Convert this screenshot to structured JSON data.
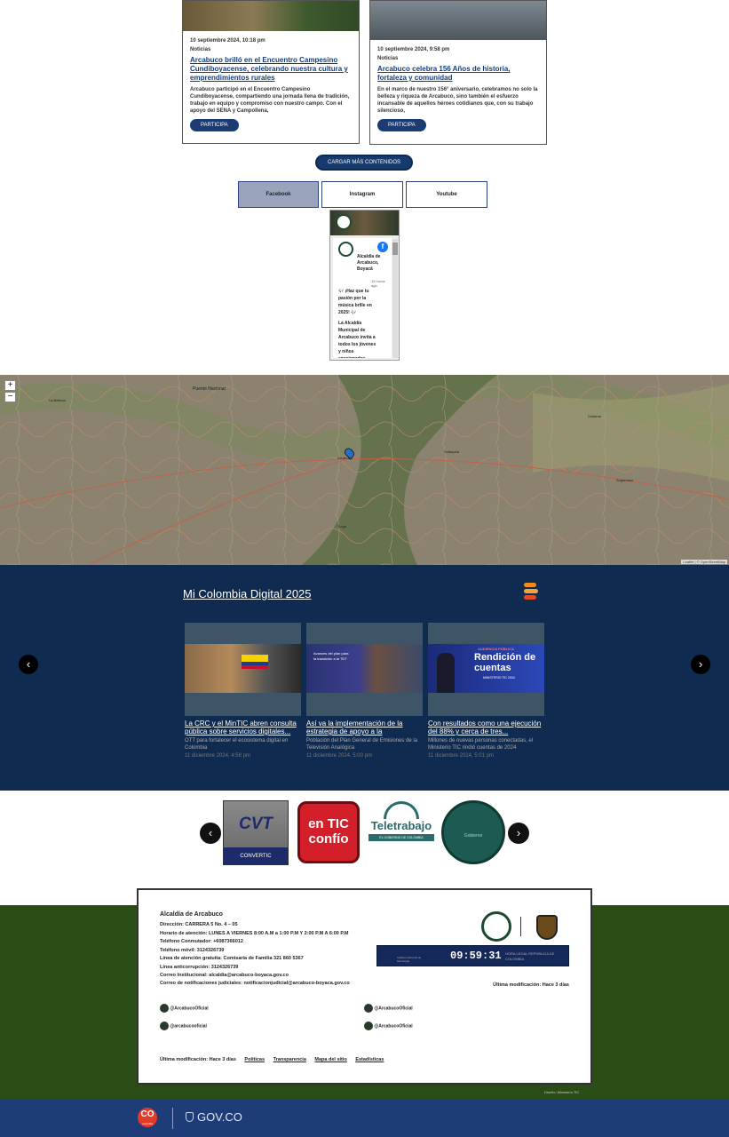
{
  "news": [
    {
      "date": "10 septiembre 2024, 10:18 pm",
      "category": "Noticias",
      "title": "Arcabuco brilló en el Encuentro Campesino Cundiboyacense, celebrando nuestra cultura y emprendimientos rurales",
      "body": "Arcabuco participó en el Encuentro Campesino Cundiboyacense, compartiendo una jornada llena de tradición, trabajo en equipo y compromiso con nuestro campo. Con el apoyo del SENA y Campollena,",
      "button": "PARTICIPA"
    },
    {
      "date": "10 septiembre 2024, 9:58 pm",
      "category": "Noticias",
      "title": "Arcabuco celebra 156 Años de historia, fortaleza y comunidad",
      "body": "En el marco de nuestro 156° aniversario, celebramos no solo la belleza y riqueza de Arcabuco, sino también el esfuerzo incansable de aquellos héroes cotidianos que, con su trabajo silencioso,",
      "button": "PARTICIPA"
    }
  ],
  "load_more": "CARGAR MÁS CONTENIDOS",
  "social_tabs": [
    "Facebook",
    "Instagram",
    "Youtube"
  ],
  "fb_widget": {
    "page_name": "Alcaldía de Arcabuco, Boyacá",
    "time": "15 horas ago",
    "post_line1": "🎶 ¡Haz que tu pasión por la música brille en 2025! 🎶",
    "post_line2": "La Alcaldía Municipal de Arcabuco invita a todos los jóvenes y niños apasionados"
  },
  "map": {
    "zoom_in": "+",
    "zoom_out": "−",
    "places": [
      "Puente Nacional",
      "La Belleza",
      "Arcabuco",
      "Duitama",
      "Sogamoso",
      "Sotaquirá",
      "Tunja"
    ],
    "attribution": "Leaflet | © OpenStreetMap"
  },
  "mi_colombia": {
    "title": "Mi Colombia Digital 2025",
    "prev": "‹",
    "next": "›",
    "cards": [
      {
        "title": "La CRC y el MinTIC abren consulta pública sobre servicios digitales...",
        "summary": "OTT para fortalecer el ecosistema digital en Colombia",
        "date": "11 diciembre 2024, 4:58 pm"
      },
      {
        "title": "Así va la implementación de la estrategia de apoyo a la",
        "summary": "Población del Plan General de Emisiones de la Televisión Analógica",
        "date": "11 diciembre 2024, 5:00 pm",
        "image_text": "Avances del plan para la transición a la TDT"
      },
      {
        "title": "Con resultados como una ejecución del 88% y cerca de tres...",
        "summary": "Millones de nuevas personas conectadas, el Ministerio TIC rindió cuentas de 2024",
        "date": "11 diciembre 2024, 5:01 pm",
        "image_text_1": "AUDIENCIA PÚBLICA",
        "image_text_2": "Rendición de cuentas",
        "image_text_3": "MINISTERIO TIC 2024"
      }
    ]
  },
  "partner_logos": {
    "prev": "‹",
    "next": "›",
    "items": [
      {
        "name": "CONVERTIC",
        "mark": "CVT",
        "caption": "CONVERTIC"
      },
      {
        "name": "En TIC Confío",
        "mark": "en TIC confío"
      },
      {
        "name": "Teletrabajo",
        "mark": "Teletrabajo",
        "caption": "EL GOBIERNO DE COLOMBIA"
      },
      {
        "name": "Gobierno Digital",
        "mark": "Gobierno"
      }
    ]
  },
  "footer": {
    "entity": "Alcaldía de Arcabuco",
    "lines": [
      "Dirección: CARRERA 5 No. 4 – 05",
      "Horario de atención: LUNES A VIERNES 8:00 A.M a 1:00 P.M Y 2:00 P.M A 6:00 P.M",
      "Teléfono Conmutador: +6087366012",
      "Teléfono móvil: 3124326739",
      "Línea de atención gratuita: Comisaría de Familia 321 860 5367",
      "Línea anticorrupción: 3124326739",
      "Correo Institucional: alcaldia@arcabuco-boyaca.gov.co",
      "Correo de notificaciones judiciales: notificacionjudicial@arcabuco-boyaca.gov.co"
    ],
    "clock_time": "09:59:31",
    "clock_label": "HORA LEGAL REPÚBLICA DE COLOMBIA",
    "clock_org": "Instituto Nacional de Metrología",
    "last_modified_right": "Última modificación: Hace 3 días",
    "social": [
      {
        "icon": "facebook-icon",
        "handle": "@ArcabucoOficial"
      },
      {
        "icon": "twitter-icon",
        "handle": "@ArcabucoOficial"
      },
      {
        "icon": "email-icon",
        "handle": "@arcabucooficial"
      },
      {
        "icon": "instagram-icon",
        "handle": "@ArcabucoOficial"
      }
    ],
    "last_modified_bottom": "Última modificación: Hace 3 días",
    "links": [
      "Políticas",
      "Transparencia",
      "Mapa del sitio",
      "Estadísticas"
    ],
    "credit": "Diseño: Ministerio TIC"
  },
  "gov": {
    "co_label": "CO",
    "co_sub": "colombia",
    "govco": "GOV.CO"
  }
}
